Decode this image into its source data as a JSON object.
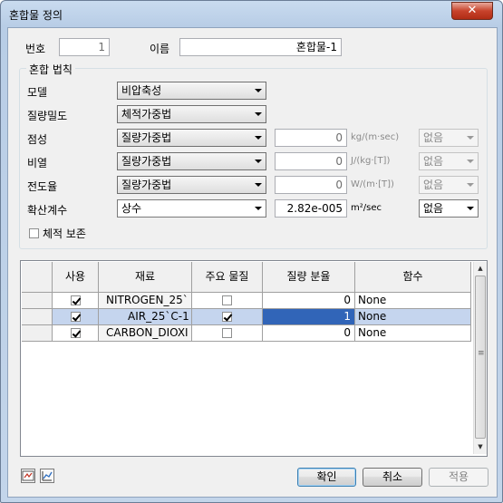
{
  "window": {
    "title": "혼합물 정의",
    "close_glyph": "✕"
  },
  "header": {
    "number_label": "번호",
    "number_value": "1",
    "name_label": "이름",
    "name_value": "혼합물-1"
  },
  "mix_rules": {
    "group_label": "혼합 법칙",
    "rows": [
      {
        "label": "모델",
        "combo": "비압축성"
      },
      {
        "label": "질량밀도",
        "combo": "체적가중법"
      },
      {
        "label": "점성",
        "combo": "질량가중법",
        "value": "0",
        "unit": "kg/(m·sec)",
        "option": "없음"
      },
      {
        "label": "비열",
        "combo": "질량가중법",
        "value": "0",
        "unit": "J/(kg·[T])",
        "option": "없음"
      },
      {
        "label": "전도율",
        "combo": "질량가중법",
        "value": "0",
        "unit": "W/(m·[T])",
        "option": "없음"
      },
      {
        "label": "확산계수",
        "combo": "상수",
        "value": "2.82e-005",
        "unit": "m²/sec",
        "option": "없음"
      }
    ],
    "volume_conservation_label": "체적 보존"
  },
  "grid": {
    "columns": [
      "사용",
      "재료",
      "주요 물질",
      "질량 분율",
      "함수"
    ],
    "rows": [
      {
        "use": true,
        "material": "NITROGEN_25`",
        "primary": false,
        "fraction": "0",
        "function": "None",
        "selected": false
      },
      {
        "use": true,
        "material": "AIR_25`C-1",
        "primary": true,
        "fraction": "1",
        "function": "None",
        "selected": true
      },
      {
        "use": true,
        "material": "CARBON_DIOXI",
        "primary": false,
        "fraction": "0",
        "function": "None",
        "selected": false
      }
    ],
    "scroll_up": "▲",
    "scroll_down": "▼",
    "grip": "≡"
  },
  "buttons": {
    "ok": "확인",
    "cancel": "취소",
    "apply": "적용"
  },
  "colors": {
    "selection": "#3165b8",
    "selection_row": "#c5d5ee"
  }
}
